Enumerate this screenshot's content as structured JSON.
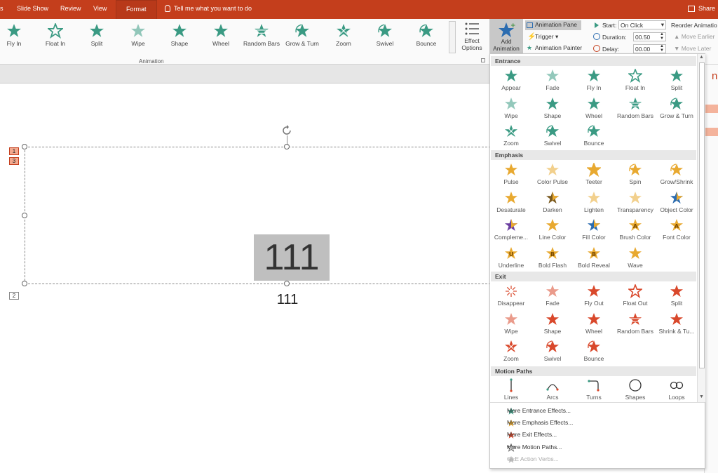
{
  "tabs": [
    {
      "label": "s"
    },
    {
      "label": "Slide Show"
    },
    {
      "label": "Review"
    },
    {
      "label": "View"
    },
    {
      "label": "Format"
    }
  ],
  "tell_me": "Tell me what you want to do",
  "share": "Share",
  "ribbon": {
    "animations": [
      {
        "label": "Fly In"
      },
      {
        "label": "Float In"
      },
      {
        "label": "Split"
      },
      {
        "label": "Wipe"
      },
      {
        "label": "Shape"
      },
      {
        "label": "Wheel"
      },
      {
        "label": "Random Bars"
      },
      {
        "label": "Grow & Turn"
      },
      {
        "label": "Zoom"
      },
      {
        "label": "Swivel"
      },
      {
        "label": "Bounce"
      }
    ],
    "animation_group": "Animation",
    "effect_options": "Effect",
    "effect_options2": "Options",
    "add_animation": "Add",
    "add_animation2": "Animation",
    "animation_pane": "Animation Pane",
    "trigger": "Trigger",
    "animation_painter": "Animation Painter",
    "start_label": "Start:",
    "start_value": "On Click",
    "duration_label": "Duration:",
    "duration_value": "00.50",
    "delay_label": "Delay:",
    "delay_value": "00.00",
    "reorder": "Reorder Animatio",
    "move_earlier": "Move Earlier",
    "move_later": "Move Later"
  },
  "slide": {
    "text_large": "111",
    "text_small": "111",
    "tag1": "1",
    "tag3": "3",
    "tag2": "2"
  },
  "right_pane_fragment": "n P",
  "dropdown": {
    "sections": [
      {
        "title": "Entrance"
      },
      {
        "title": "Emphasis"
      },
      {
        "title": "Exit"
      },
      {
        "title": "Motion Paths"
      }
    ],
    "entrance": [
      "Appear",
      "Fade",
      "Fly In",
      "Float In",
      "Split",
      "Wipe",
      "Shape",
      "Wheel",
      "Random Bars",
      "Grow & Turn",
      "Zoom",
      "Swivel",
      "Bounce"
    ],
    "emphasis": [
      "Pulse",
      "Color Pulse",
      "Teeter",
      "Spin",
      "Grow/Shrink",
      "Desaturate",
      "Darken",
      "Lighten",
      "Transparency",
      "Object Color",
      "Compleme...",
      "Line Color",
      "Fill Color",
      "Brush Color",
      "Font Color",
      "Underline",
      "Bold Flash",
      "Bold Reveal",
      "Wave"
    ],
    "exit": [
      "Disappear",
      "Fade",
      "Fly Out",
      "Float Out",
      "Split",
      "Wipe",
      "Shape",
      "Wheel",
      "Random Bars",
      "Shrink & Tu...",
      "Zoom",
      "Swivel",
      "Bounce"
    ],
    "motion": [
      "Lines",
      "Arcs",
      "Turns",
      "Shapes",
      "Loops"
    ],
    "more": [
      "More Entrance Effects...",
      "More Emphasis Effects...",
      "More Exit Effects...",
      "More Motion Paths...",
      "OLE Action Verbs..."
    ]
  },
  "colors": {
    "accent": "#c43e1c",
    "entrance": "#3a9a83",
    "emphasis": "#e8a930",
    "exit": "#d9482b"
  }
}
